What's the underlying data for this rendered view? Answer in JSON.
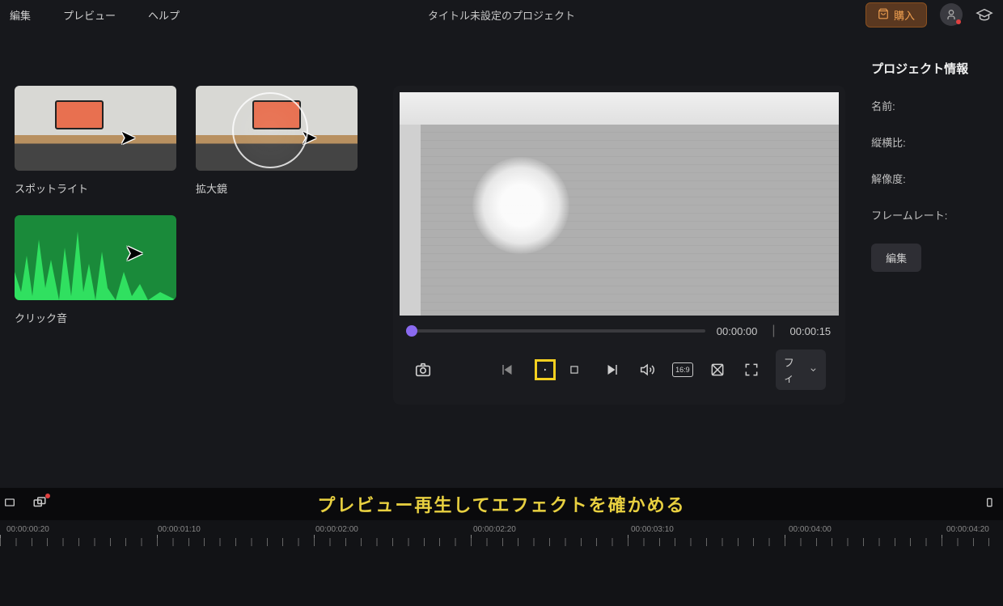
{
  "menu": {
    "edit": "編集",
    "preview": "プレビュー",
    "help": "ヘルプ"
  },
  "project_title": "タイトル未設定のプロジェクト",
  "buy_label": "購入",
  "effects": {
    "spotlight": "スポットライト",
    "magnifier": "拡大鏡",
    "click_sound": "クリック音"
  },
  "playback": {
    "current": "00:00:00",
    "total": "00:00:15",
    "fit_label": "フィ"
  },
  "info": {
    "title": "プロジェクト情報",
    "name_label": "名前:",
    "aspect_label": "縦横比:",
    "resolution_label": "解像度:",
    "framerate_label": "フレームレート:",
    "edit_btn": "編集"
  },
  "banner_text": "プレビュー再生してエフェクトを確かめる",
  "ruler_marks": [
    "00:00:00:20",
    "00:00:01:10",
    "00:00:02:00",
    "00:00:02:20",
    "00:00:03:10",
    "00:00:04:00",
    "00:00:04:20"
  ]
}
